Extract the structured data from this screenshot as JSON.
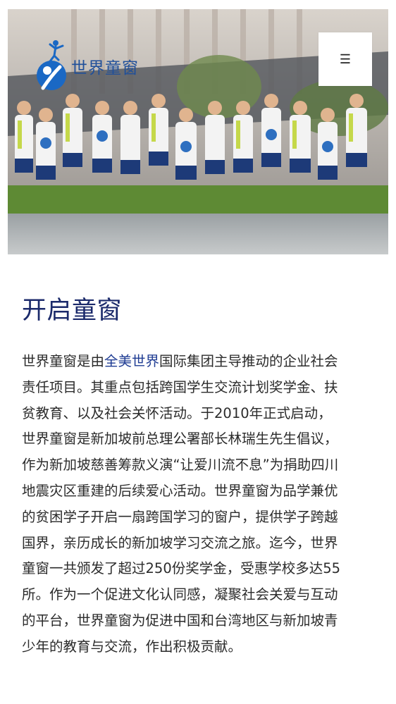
{
  "header": {
    "logo_text": "世界童窗",
    "logo_icon": "jumping-child-logo-icon",
    "menu_icon": "☰",
    "hero_image": "children-jumping-photo"
  },
  "colors": {
    "title": "#1b2a6b",
    "link": "#1f3c93",
    "logo": "#1f4f9a",
    "body_text": "#2b2b2b"
  },
  "main": {
    "title": "开启童窗",
    "paragraph": {
      "l1_pre": "世界童窗是由",
      "l1_link": "全美世界",
      "l1_post": "国际集团主导推动的企业社会",
      "l2": "责任项目。其重点包括跨国学生交流计划奖学金、扶",
      "l3": "贫教育、以及社会关怀活动。于2010年正式启动，",
      "l4": "世界童窗是新加坡前总理公署部长林瑞生先生倡议，",
      "l5": "作为新加坡慈善筹款义演“让爱川流不息”为捐助四川",
      "l6": "地震灾区重建的后续爱心活动。世界童窗为品学兼优",
      "l7": "的贫困学子开启一扇跨国学习的窗户，提供学子跨越",
      "l8": "国界，亲历成长的新加坡学习交流之旅。迄今，世界",
      "l9": "童窗一共颁发了超过250份奖学金，受惠学校多达55",
      "l10": "所。作为一个促进文化认同感，凝聚社会关爱与互动",
      "l11": "的平台，世界童窗为促进中国和台湾地区与新加坡青",
      "l12": "少年的教育与交流，作出积极贡献。"
    }
  }
}
